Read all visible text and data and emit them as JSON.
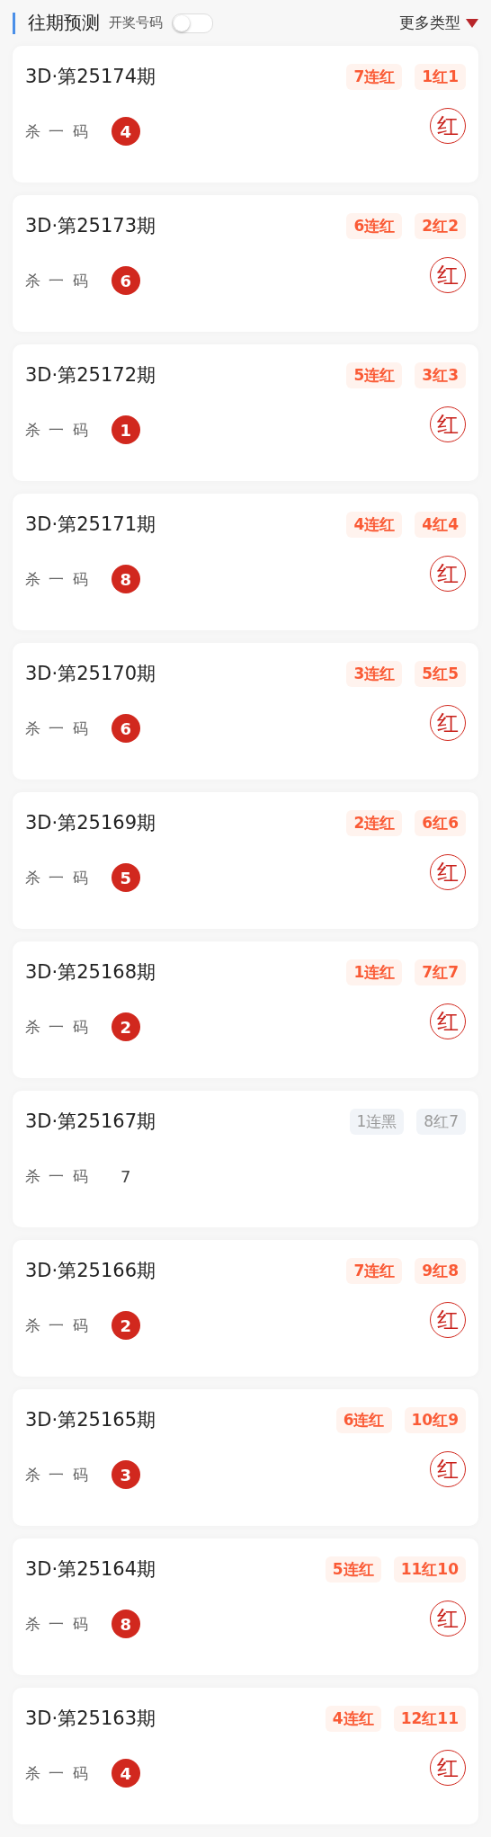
{
  "header": {
    "title": "往期预测",
    "toggle": {
      "label": "开奖号码",
      "on": false
    },
    "more": "更多类型"
  },
  "items": [
    {
      "period": "3D·第25174期",
      "streak": "7连红",
      "record": "1红1",
      "label": "杀 一 码",
      "number": "4",
      "hit": true,
      "stamp": "红"
    },
    {
      "period": "3D·第25173期",
      "streak": "6连红",
      "record": "2红2",
      "label": "杀 一 码",
      "number": "6",
      "hit": true,
      "stamp": "红"
    },
    {
      "period": "3D·第25172期",
      "streak": "5连红",
      "record": "3红3",
      "label": "杀 一 码",
      "number": "1",
      "hit": true,
      "stamp": "红"
    },
    {
      "period": "3D·第25171期",
      "streak": "4连红",
      "record": "4红4",
      "label": "杀 一 码",
      "number": "8",
      "hit": true,
      "stamp": "红"
    },
    {
      "period": "3D·第25170期",
      "streak": "3连红",
      "record": "5红5",
      "label": "杀 一 码",
      "number": "6",
      "hit": true,
      "stamp": "红"
    },
    {
      "period": "3D·第25169期",
      "streak": "2连红",
      "record": "6红6",
      "label": "杀 一 码",
      "number": "5",
      "hit": true,
      "stamp": "红"
    },
    {
      "period": "3D·第25168期",
      "streak": "1连红",
      "record": "7红7",
      "label": "杀 一 码",
      "number": "2",
      "hit": true,
      "stamp": "红"
    },
    {
      "period": "3D·第25167期",
      "streak": "1连黑",
      "record": "8红7",
      "label": "杀 一 码",
      "number": "7",
      "hit": false
    },
    {
      "period": "3D·第25166期",
      "streak": "7连红",
      "record": "9红8",
      "label": "杀 一 码",
      "number": "2",
      "hit": true,
      "stamp": "红"
    },
    {
      "period": "3D·第25165期",
      "streak": "6连红",
      "record": "10红9",
      "label": "杀 一 码",
      "number": "3",
      "hit": true,
      "stamp": "红"
    },
    {
      "period": "3D·第25164期",
      "streak": "5连红",
      "record": "11红10",
      "label": "杀 一 码",
      "number": "8",
      "hit": true,
      "stamp": "红"
    },
    {
      "period": "3D·第25163期",
      "streak": "4连红",
      "record": "12红11",
      "label": "杀 一 码",
      "number": "4",
      "hit": true,
      "stamp": "红"
    }
  ]
}
